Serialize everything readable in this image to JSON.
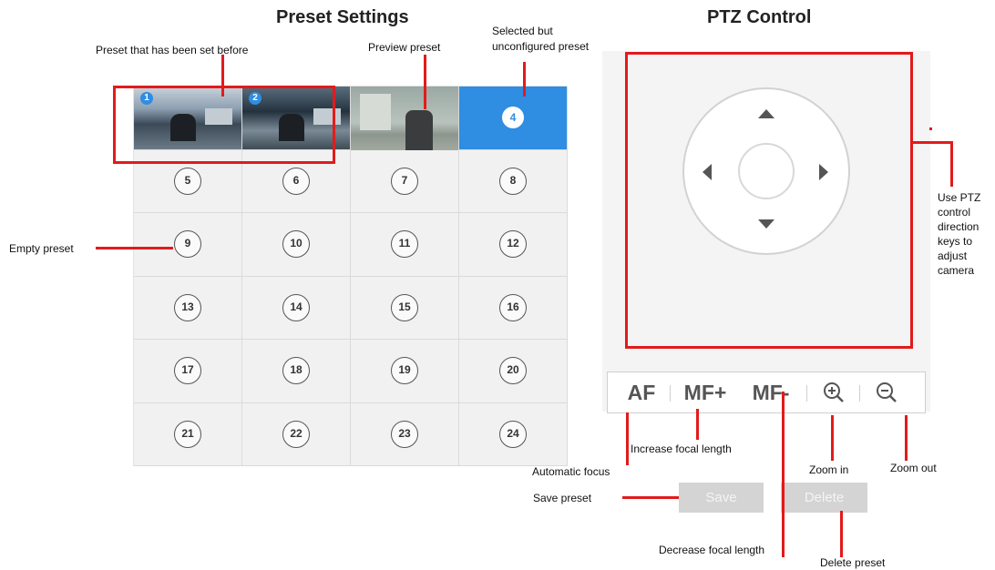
{
  "preset_settings": {
    "title": "Preset Settings",
    "cells": [
      {
        "label": "1",
        "state": "set"
      },
      {
        "label": "2",
        "state": "set"
      },
      {
        "label": "",
        "state": "preview"
      },
      {
        "label": "4",
        "state": "selected"
      },
      {
        "label": "5",
        "state": "empty"
      },
      {
        "label": "6",
        "state": "empty"
      },
      {
        "label": "7",
        "state": "empty"
      },
      {
        "label": "8",
        "state": "empty"
      },
      {
        "label": "9",
        "state": "empty"
      },
      {
        "label": "10",
        "state": "empty"
      },
      {
        "label": "11",
        "state": "empty"
      },
      {
        "label": "12",
        "state": "empty"
      },
      {
        "label": "13",
        "state": "empty"
      },
      {
        "label": "14",
        "state": "empty"
      },
      {
        "label": "15",
        "state": "empty"
      },
      {
        "label": "16",
        "state": "empty"
      },
      {
        "label": "17",
        "state": "empty"
      },
      {
        "label": "18",
        "state": "empty"
      },
      {
        "label": "19",
        "state": "empty"
      },
      {
        "label": "20",
        "state": "empty"
      },
      {
        "label": "21",
        "state": "empty"
      },
      {
        "label": "22",
        "state": "empty"
      },
      {
        "label": "23",
        "state": "empty"
      },
      {
        "label": "24",
        "state": "empty"
      }
    ],
    "save_label": "Save",
    "delete_label": "Delete"
  },
  "ptz": {
    "title": "PTZ Control",
    "af_label": "AF",
    "mf_plus_label": "MF+",
    "mf_minus_label": "MF-",
    "zoom_in_icon": "zoom-in-icon",
    "zoom_out_icon": "zoom-out-icon"
  },
  "annotations": {
    "preset_set_before": "Preset that has been set before",
    "preview_preset": "Preview preset",
    "selected_unconfigured_1": "Selected but",
    "selected_unconfigured_2": "unconfigured preset",
    "empty_preset": "Empty  preset",
    "use_ptz": "Use PTZ control direction keys to adjust camera",
    "increase_focal": "Increase  focal length",
    "automatic_focus": "Automatic  focus",
    "zoom_in": "Zoom  in",
    "zoom_out": "Zoom  out",
    "save_preset": "Save preset",
    "decrease_focal": "Decrease  focal length",
    "delete_preset": "Delete  preset"
  },
  "colors": {
    "accent": "#2f8de2",
    "annotation_red": "#e21b1b",
    "button_grey": "#d4d4d4"
  }
}
